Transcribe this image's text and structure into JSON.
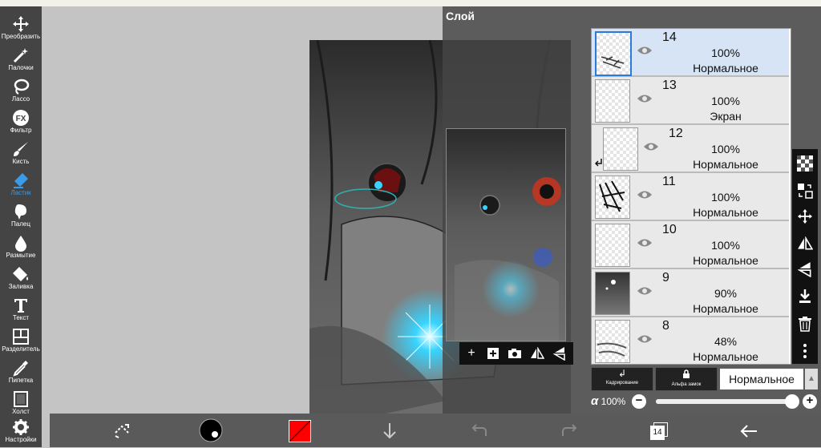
{
  "tools": [
    {
      "label": "Преобразить",
      "icon": "move-icon"
    },
    {
      "label": "Палочки",
      "icon": "magic-wand-icon"
    },
    {
      "label": "Лассо",
      "icon": "lasso-icon"
    },
    {
      "label": "Фильтр",
      "icon": "fx-icon"
    },
    {
      "label": "Кисть",
      "icon": "brush-icon"
    },
    {
      "label": "Ластик",
      "icon": "eraser-icon",
      "active": true
    },
    {
      "label": "Палец",
      "icon": "smudge-icon"
    },
    {
      "label": "Размытие",
      "icon": "blur-icon"
    },
    {
      "label": "Заливка",
      "icon": "fill-icon"
    },
    {
      "label": "Текст",
      "icon": "text-icon"
    },
    {
      "label": "Разделитель",
      "icon": "divider-icon"
    },
    {
      "label": "Пипетка",
      "icon": "eyedropper-icon"
    },
    {
      "label": "Холст",
      "icon": "canvas-icon"
    },
    {
      "label": "Настройки",
      "icon": "gear-icon"
    }
  ],
  "panel": {
    "title": "Слой"
  },
  "layers": [
    {
      "num": "14",
      "opacity": "100%",
      "mode": "Нормальное",
      "selected": true
    },
    {
      "num": "13",
      "opacity": "100%",
      "mode": "Экран"
    },
    {
      "num": "12",
      "opacity": "100%",
      "mode": "Нормальное",
      "clipped": true
    },
    {
      "num": "11",
      "opacity": "100%",
      "mode": "Нормальное"
    },
    {
      "num": "10",
      "opacity": "100%",
      "mode": "Нормальное"
    },
    {
      "num": "9",
      "opacity": "90%",
      "mode": "Нормальное"
    },
    {
      "num": "8",
      "opacity": "48%",
      "mode": "Нормальное"
    }
  ],
  "layer_controls": {
    "clipping_label": "Кадрирование",
    "alpha_lock_label": "Альфа замок",
    "blend_mode": "Нормальное",
    "alpha_symbol": "α",
    "opacity": "100%",
    "opacity_value": 1.0
  },
  "bottom": {
    "layer_count": "14"
  },
  "colors": {
    "primary": "#ff0000",
    "accent": "#3a9be8",
    "selected_layer": "#d6e4f6"
  }
}
